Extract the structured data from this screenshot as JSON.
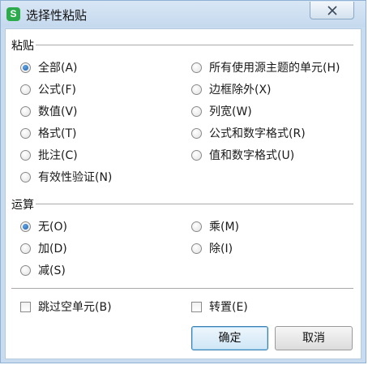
{
  "window": {
    "title": "选择性粘贴",
    "icon": "S"
  },
  "paste": {
    "group_title": "粘贴",
    "options_left": [
      {
        "label": "全部(A)",
        "checked": true
      },
      {
        "label": "公式(F)",
        "checked": false
      },
      {
        "label": "数值(V)",
        "checked": false
      },
      {
        "label": "格式(T)",
        "checked": false
      },
      {
        "label": "批注(C)",
        "checked": false
      },
      {
        "label": "有效性验证(N)",
        "checked": false
      }
    ],
    "options_right": [
      {
        "label": "所有使用源主题的单元(H)",
        "checked": false
      },
      {
        "label": "边框除外(X)",
        "checked": false
      },
      {
        "label": "列宽(W)",
        "checked": false
      },
      {
        "label": "公式和数字格式(R)",
        "checked": false
      },
      {
        "label": "值和数字格式(U)",
        "checked": false
      }
    ]
  },
  "operation": {
    "group_title": "运算",
    "options_left": [
      {
        "label": "无(O)",
        "checked": true
      },
      {
        "label": "加(D)",
        "checked": false
      },
      {
        "label": "减(S)",
        "checked": false
      }
    ],
    "options_right": [
      {
        "label": "乘(M)",
        "checked": false
      },
      {
        "label": "除(I)",
        "checked": false
      }
    ]
  },
  "checkboxes": {
    "skip_blanks": {
      "label": "跳过空单元(B)",
      "checked": false
    },
    "transpose": {
      "label": "转置(E)",
      "checked": false
    }
  },
  "buttons": {
    "ok": "确定",
    "cancel": "取消"
  },
  "colors": {
    "frame": "#c9dcef",
    "radio_selected": "#1f5fa8",
    "default_button_border": "#3c7fb1"
  }
}
